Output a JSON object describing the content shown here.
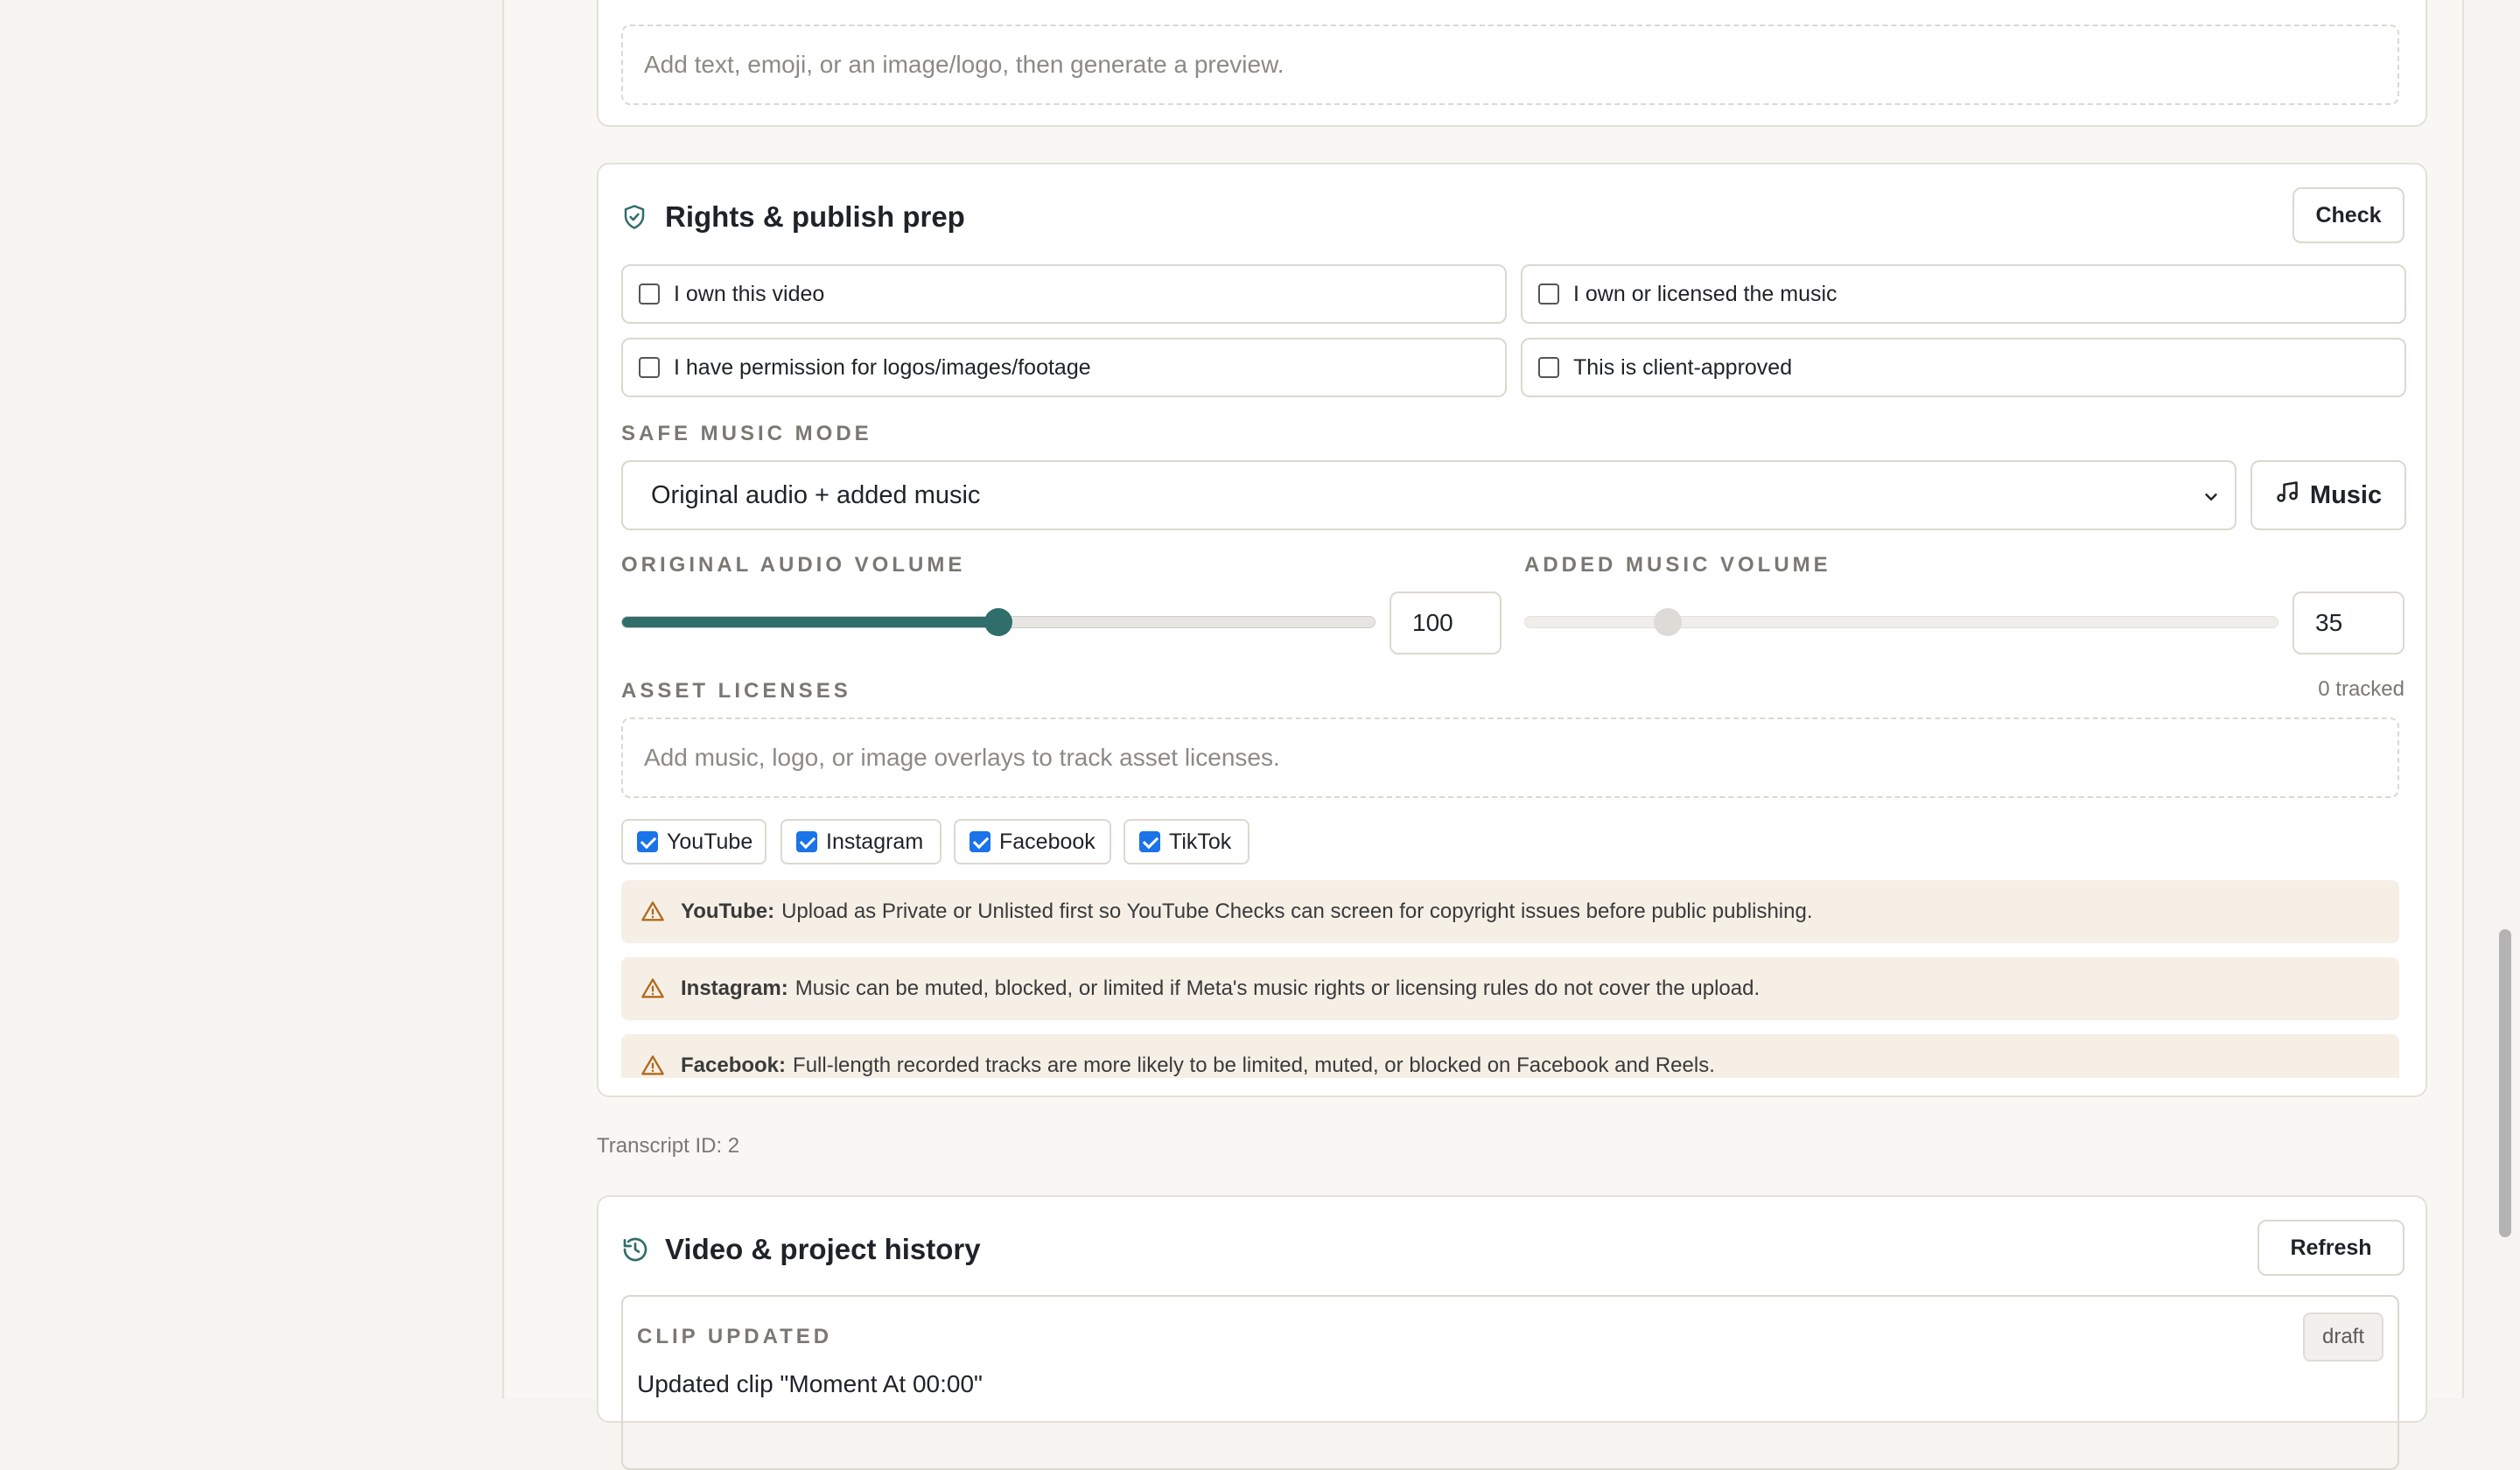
{
  "preview": {
    "placeholder": "Add text, emoji, or an image/logo, then generate a preview."
  },
  "rights": {
    "title": "Rights & publish prep",
    "icon": "shield-check-icon",
    "check_label": "Check",
    "checkboxes": [
      {
        "label": "I own this video",
        "checked": false
      },
      {
        "label": "I own or licensed the music",
        "checked": false
      },
      {
        "label": "I have permission for logos/images/footage",
        "checked": false
      },
      {
        "label": "This is client-approved",
        "checked": false
      }
    ],
    "safe_music_mode_label": "SAFE MUSIC MODE",
    "safe_music_mode_value": "Original audio + added music",
    "music_button_label": "Music",
    "original_volume_label": "ORIGINAL AUDIO VOLUME",
    "original_volume_value": "100",
    "original_volume_level": 0.5,
    "added_volume_label": "ADDED MUSIC VOLUME",
    "added_volume_value": "35",
    "added_volume_level": 0.19,
    "asset_licenses_label": "ASSET LICENSES",
    "asset_tracked": "0 tracked",
    "asset_placeholder": "Add music, logo, or image overlays to track asset licenses.",
    "platforms": [
      {
        "label": "YouTube",
        "checked": true
      },
      {
        "label": "Instagram",
        "checked": true
      },
      {
        "label": "Facebook",
        "checked": true
      },
      {
        "label": "TikTok",
        "checked": true
      }
    ],
    "notices": [
      {
        "platform": "YouTube:",
        "text": "Upload as Private or Unlisted first so YouTube Checks can screen for copyright issues before public publishing."
      },
      {
        "platform": "Instagram:",
        "text": "Music can be muted, blocked, or limited if Meta's music rights or licensing rules do not cover the upload."
      },
      {
        "platform": "Facebook:",
        "text": "Full-length recorded tracks are more likely to be limited, muted, or blocked on Facebook and Reels."
      }
    ],
    "accent_color": "#2f6e6b"
  },
  "transcript": "Transcript ID: 2",
  "history": {
    "title": "Video & project history",
    "icon": "history-icon",
    "refresh_label": "Refresh",
    "items": [
      {
        "type": "CLIP UPDATED",
        "text": "Updated clip \"Moment At 00:00\"",
        "badge": "draft"
      }
    ]
  }
}
